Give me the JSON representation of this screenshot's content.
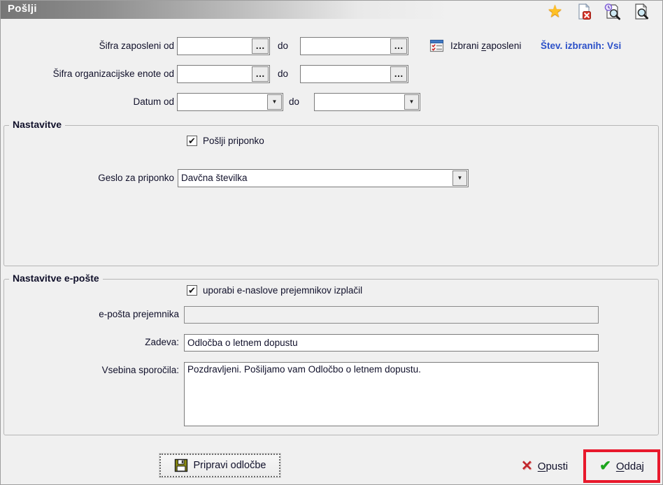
{
  "window": {
    "title": "Pošlji"
  },
  "toolbar": {
    "icons": [
      {
        "name": "favorite-star-icon",
        "shape": "★ gold star"
      },
      {
        "name": "close-report-icon",
        "shape": "document with red x badge"
      },
      {
        "name": "employee-preview-icon",
        "shape": "document with clock and magnifier"
      },
      {
        "name": "report-preview-icon",
        "shape": "document with magnifier"
      }
    ]
  },
  "filters": {
    "row1": {
      "label": "Šifra zaposleni od",
      "do_label": "do",
      "from_value": "",
      "to_value": ""
    },
    "row2": {
      "label": "Šifra organizacijske enote od",
      "do_label": "do",
      "from_value": "",
      "to_value": ""
    },
    "row3": {
      "label": "Datum od",
      "do_label": "do",
      "from_value": "",
      "to_value": ""
    },
    "selected": {
      "link_pre": "Izbrani ",
      "link_key": "z",
      "link_post": "aposleni",
      "count": "Štev. izbranih: Vsi"
    }
  },
  "settings": {
    "title": "Nastavitve",
    "attachment_checkbox_label": "Pošlji priponko",
    "attachment_checked": true,
    "password_label": "Geslo za priponko",
    "password_value": "Davčna številka"
  },
  "email": {
    "title": "Nastavitve e-pošte",
    "use_addresses_label": "uporabi e-naslove prejemnikov izplačil",
    "use_addresses_checked": true,
    "recipient_label": "e-pošta prejemnika",
    "recipient_value": "",
    "subject_label": "Zadeva:",
    "subject_value": "Odločba o letnem dopustu",
    "body_label": "Vsebina sporočila:",
    "body_value": "Pozdravljeni. Pošiljamo vam Odločbo o letnem dopustu."
  },
  "footer": {
    "prepare_label": "Pripravi odločbe",
    "cancel_key": "O",
    "cancel_rest": "pusti",
    "submit_key": "O",
    "submit_rest": "ddaj"
  },
  "misc": {
    "ellipsis": "…",
    "dropdown_arrow": "▼",
    "check_glyph": "✔",
    "cancel_glyph": "✕",
    "star_glyph": "★"
  },
  "colors": {
    "accent_blue": "#2b50c8",
    "highlight_red": "#e8192c",
    "success_green": "#1ca51c",
    "danger_red": "#c1272d"
  }
}
